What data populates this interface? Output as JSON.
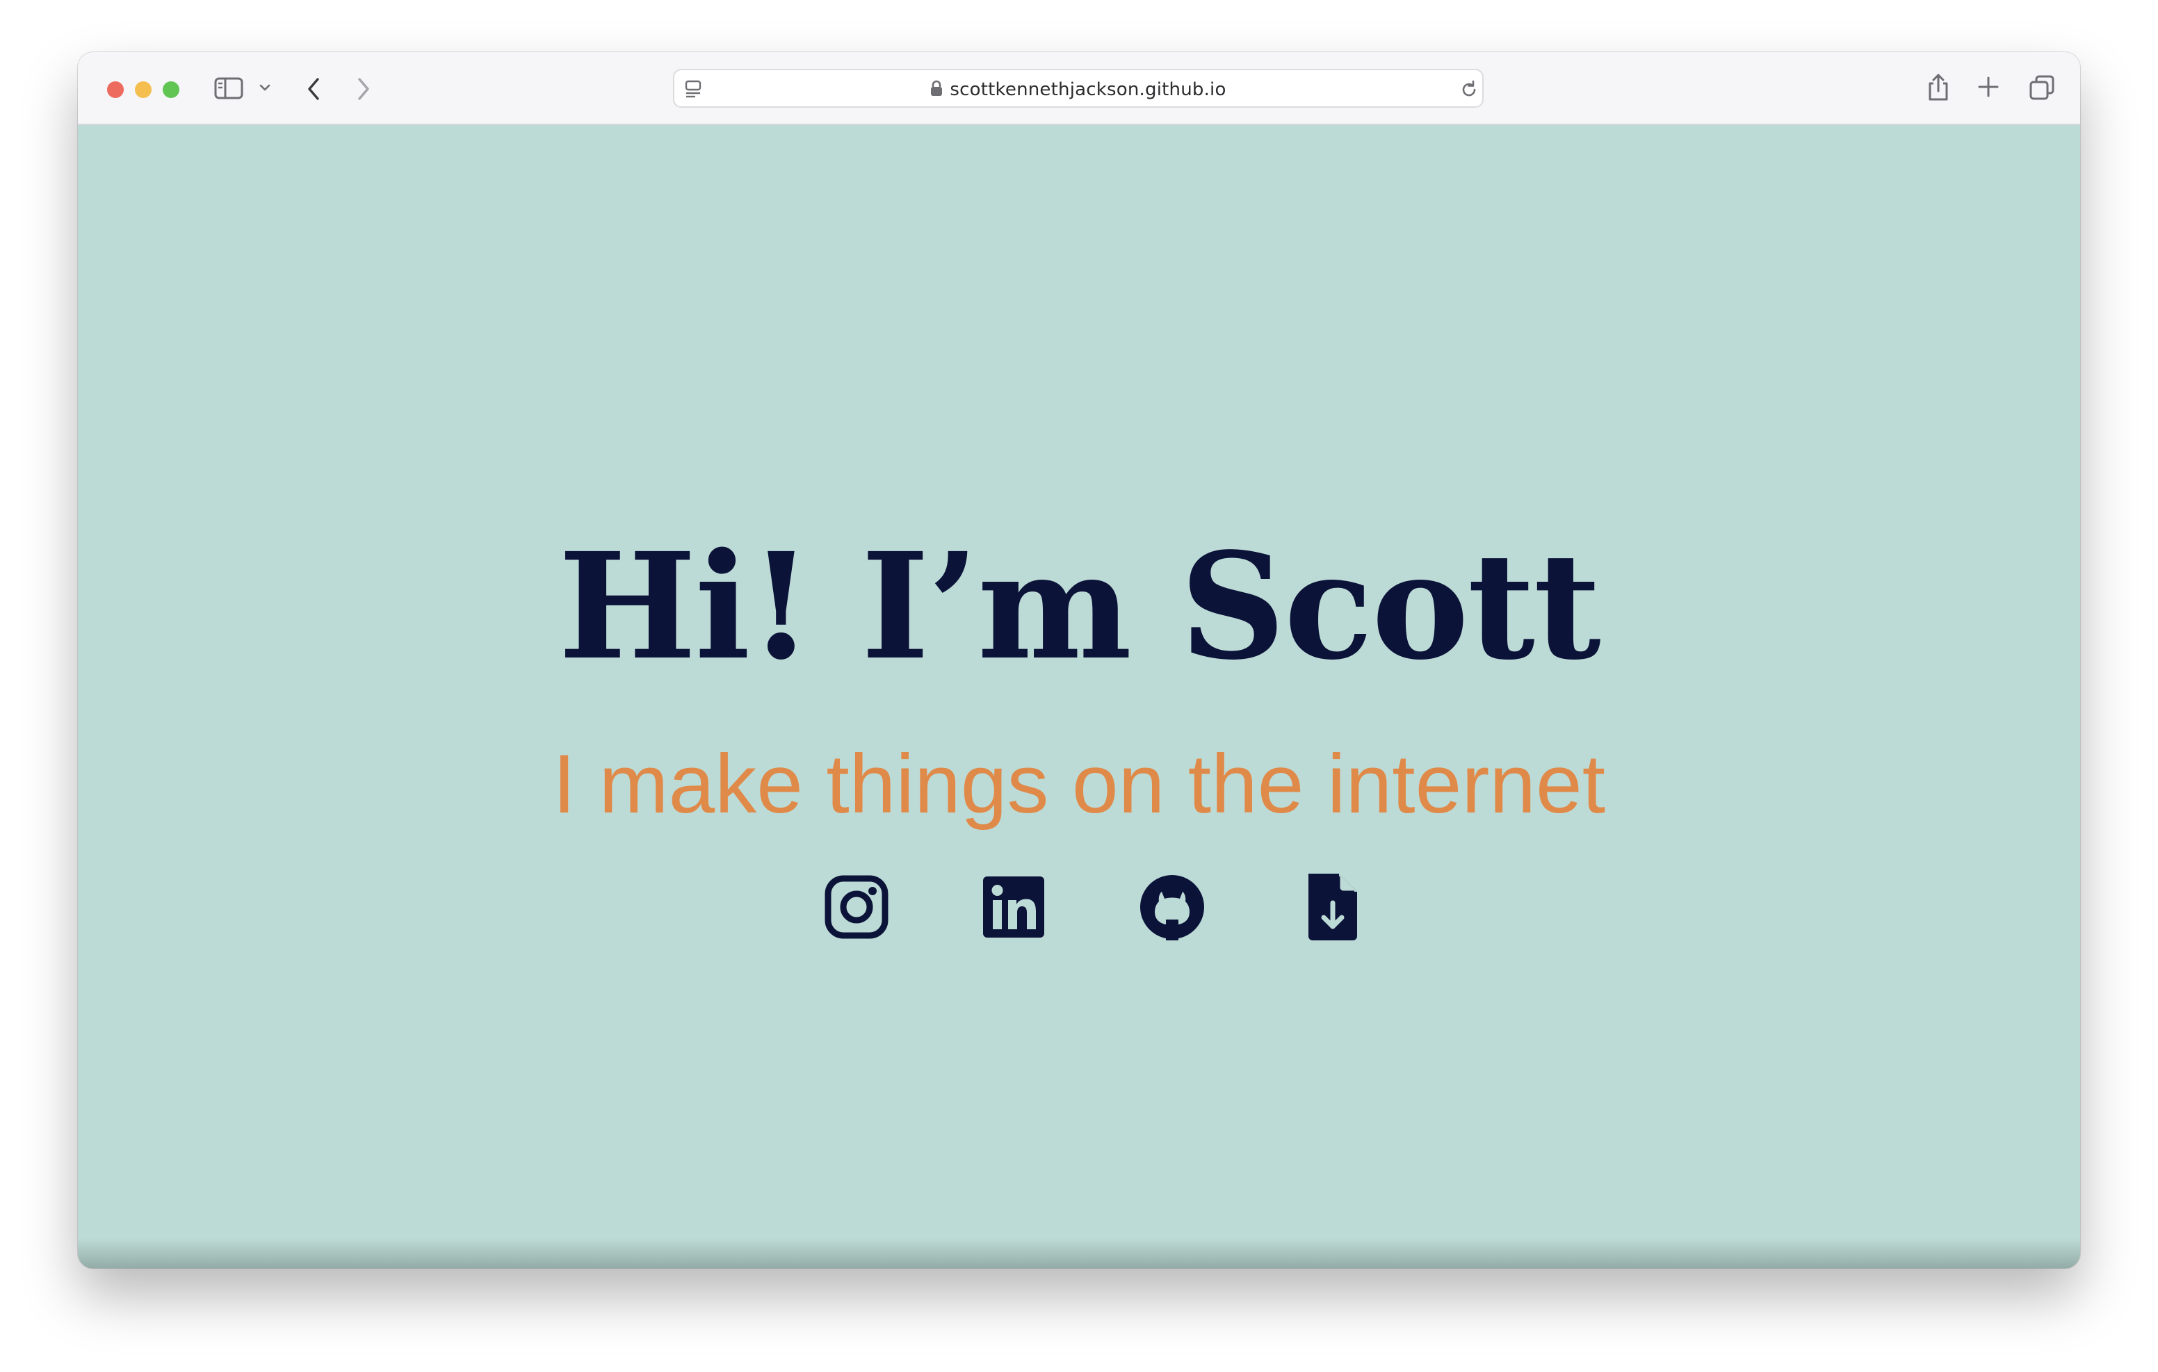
{
  "browser": {
    "url": "scottkennethjackson.github.io",
    "icons": {
      "sidebar": "sidebar-icon",
      "sidebar_menu": "chevron-down-icon",
      "back": "chevron-left-icon",
      "forward": "chevron-right-icon",
      "page_menu": "page-menu-icon",
      "lock": "lock-icon",
      "reload": "reload-icon",
      "share": "share-icon",
      "new_tab": "plus-icon",
      "tabs": "tab-overview-icon"
    }
  },
  "hero": {
    "title": "Hi! I’m Scott",
    "subtitle": "I make things on the internet"
  },
  "social": [
    {
      "icon": "instagram-icon"
    },
    {
      "icon": "linkedin-icon"
    },
    {
      "icon": "github-icon"
    },
    {
      "icon": "file-download-icon"
    }
  ],
  "colors": {
    "background": "#bddbd6",
    "title": "#0c1339",
    "subtitle": "#e08a4a",
    "icons": "#0c1339"
  }
}
